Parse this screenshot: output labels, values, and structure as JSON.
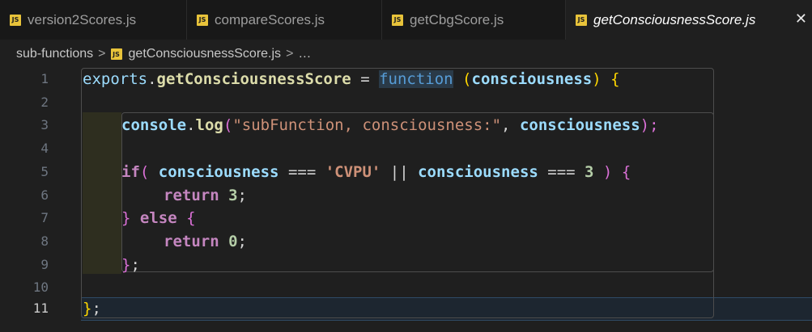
{
  "tabs": [
    {
      "label": "version2Scores.js",
      "icon": "js-file-icon"
    },
    {
      "label": "compareScores.js",
      "icon": "js-file-icon"
    },
    {
      "label": "getCbgScore.js",
      "icon": "js-file-icon"
    },
    {
      "label": "getConsciousnessScore.js",
      "icon": "js-file-icon",
      "active": true
    }
  ],
  "tab_close_glyph": "✕",
  "js_icon_text": "JS",
  "breadcrumb": {
    "folder": "sub-functions",
    "file": "getConsciousnessScore.js",
    "more": "…",
    "separator": ">"
  },
  "line_numbers": [
    "1",
    "2",
    "3",
    "4",
    "5",
    "6",
    "7",
    "8",
    "9",
    "10",
    "11"
  ],
  "code": {
    "l1": {
      "t1": "exports",
      "t2": ".",
      "t3": "getConsciousnessScore",
      "t4": " = ",
      "t5": "function",
      "t6": " ",
      "t7": "(",
      "t8": "consciousness",
      "t9": ")",
      "t10": " ",
      "t11": "{"
    },
    "l3": {
      "t1": "console",
      "t2": ".",
      "t3": "log",
      "t4": "(",
      "t5": "\"subFunction, consciousness:\"",
      "t6": ", ",
      "t7": "consciousness",
      "t8": ");"
    },
    "l5": {
      "t1": "if",
      "t2": "(",
      "t3": " consciousness",
      "t4": " === ",
      "t5": "'CVPU'",
      "t6": " || ",
      "t7": "consciousness",
      "t8": " === ",
      "t9": "3",
      "t10": " ) ",
      "t11": "{"
    },
    "l6": {
      "t1": "return",
      "t2": " ",
      "t3": "3",
      "t4": ";"
    },
    "l7": {
      "t1": "}",
      "t2": " ",
      "t3": "else",
      "t4": " ",
      "t5": "{"
    },
    "l8": {
      "t1": "return",
      "t2": " ",
      "t3": "0",
      "t4": ";"
    },
    "l9": {
      "t1": "}",
      "t2": ";"
    },
    "l11": {
      "t1": "}",
      "t2": ";"
    }
  },
  "colors": {
    "keyword": "#c586c0",
    "variable": "#9cdcfe",
    "function": "#dcdcaa",
    "string": "#ce9178",
    "number": "#b5cea8",
    "bracket": "#ffd700",
    "js_icon": "#e8c33a"
  }
}
